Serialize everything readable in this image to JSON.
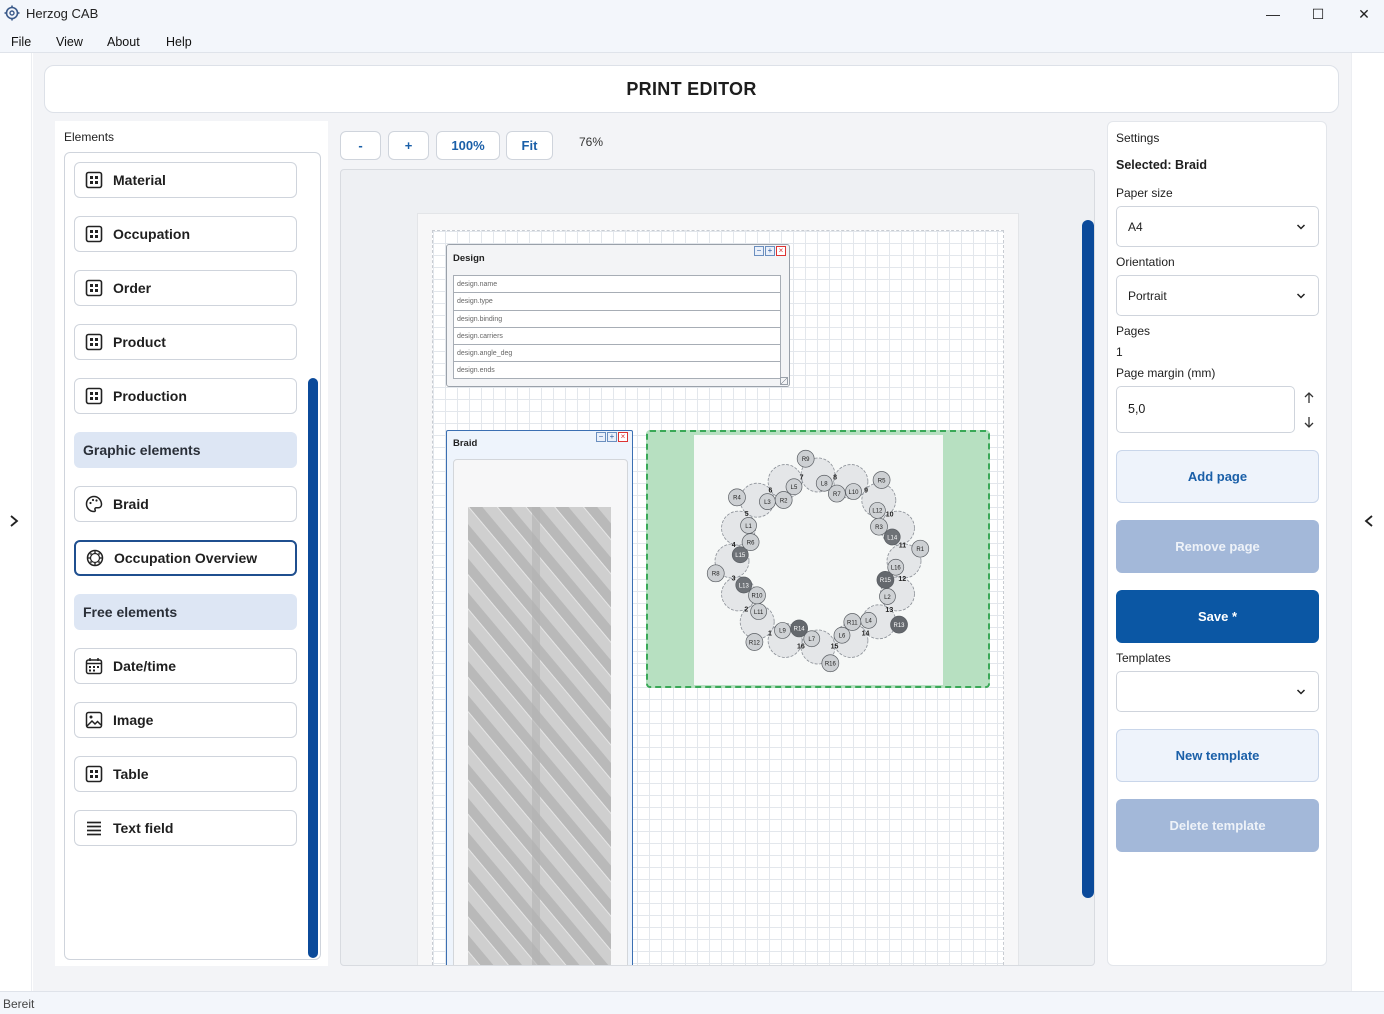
{
  "window": {
    "title": "Herzog CAB",
    "controls": {
      "minimize": "—",
      "maximize": "☐",
      "close": "✕"
    }
  },
  "menu": [
    "File",
    "View",
    "About",
    "Help"
  ],
  "header": {
    "title": "PRINT EDITOR"
  },
  "elements_panel": {
    "label": "Elements",
    "items": [
      {
        "label": "Material",
        "icon": "table-icon"
      },
      {
        "label": "Occupation",
        "icon": "table-icon"
      },
      {
        "label": "Order",
        "icon": "table-icon"
      },
      {
        "label": "Product",
        "icon": "table-icon"
      },
      {
        "label": "Production",
        "icon": "table-icon"
      }
    ],
    "graphic_section": "Graphic elements",
    "graphic_items": [
      {
        "label": "Braid",
        "icon": "palette-icon"
      },
      {
        "label": "Occupation Overview",
        "icon": "gear-wheel-icon",
        "selected": true
      }
    ],
    "free_section": "Free elements",
    "free_items": [
      {
        "label": "Date/time",
        "icon": "calendar-icon"
      },
      {
        "label": "Image",
        "icon": "image-icon"
      },
      {
        "label": "Table",
        "icon": "table-icon"
      },
      {
        "label": "Text field",
        "icon": "lines-icon"
      }
    ]
  },
  "toolbar": {
    "zoom_out": "-",
    "zoom_in": "+",
    "zoom_100": "100%",
    "fit": "Fit",
    "zoom_level": "76%"
  },
  "canvas": {
    "design_box": {
      "title": "Design",
      "rows": [
        "design.name",
        "design.type",
        "design.binding",
        "design.carriers",
        "design.angle_deg",
        "design.ends"
      ]
    },
    "braid_box": {
      "title": "Braid"
    },
    "occupation_box": {
      "outer_labels": [
        "R9",
        "R7",
        "R5",
        "R3",
        "R1",
        "R15",
        "R13",
        "R11",
        "R16",
        "R14",
        "R12",
        "R10",
        "R8",
        "R6",
        "R4",
        "R2"
      ],
      "inner_labels": [
        "L8",
        "L10",
        "L12",
        "L14",
        "L16",
        "L2",
        "L4",
        "L6",
        "L7",
        "L9",
        "L11",
        "L13",
        "L15",
        "L1",
        "L3",
        "L5"
      ],
      "numbers": [
        "8",
        "9",
        "10",
        "11",
        "12",
        "13",
        "14",
        "15",
        "16",
        "1",
        "2",
        "3",
        "4",
        "5",
        "6",
        "7"
      ]
    }
  },
  "settings": {
    "label": "Settings",
    "selected": "Selected: Braid",
    "paper_size_label": "Paper size",
    "paper_size": "A4",
    "orientation_label": "Orientation",
    "orientation": "Portrait",
    "pages_label": "Pages",
    "pages": "1",
    "margin_label": "Page margin (mm)",
    "margin": "5,0",
    "add_page": "Add page",
    "remove_page": "Remove page",
    "save": "Save *",
    "templates_label": "Templates",
    "template_value": "",
    "new_template": "New template",
    "delete_template": "Delete template"
  },
  "status": {
    "text": "Bereit"
  }
}
